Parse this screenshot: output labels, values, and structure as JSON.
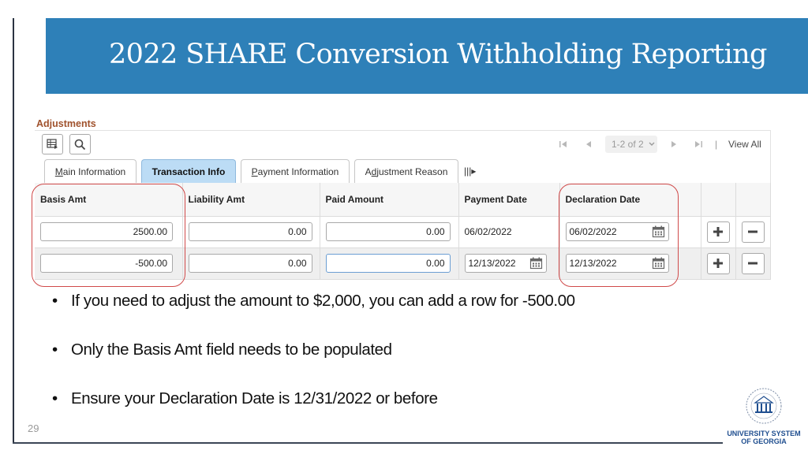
{
  "slide": {
    "title": "2022 SHARE Conversion Withholding Reporting",
    "page_number": "29",
    "accent_color": "#2e80b8",
    "highlight_color": "#d04a4a"
  },
  "grid": {
    "section_title": "Adjustments",
    "toolbar": {
      "personalize_icon": "grid-personalize-icon",
      "find_icon": "search-icon"
    },
    "pager": {
      "first_icon": "first-page-icon",
      "prev_icon": "previous-page-icon",
      "range_label": "1-2 of 2",
      "next_icon": "next-page-icon",
      "last_icon": "last-page-icon",
      "separator": "|",
      "view_all": "View All"
    },
    "tabs": [
      {
        "label_prefix": "",
        "underline": "M",
        "label_rest": "ain Information",
        "active": false
      },
      {
        "label_prefix": "",
        "underline": "",
        "label_rest": "Transaction Info",
        "active": true
      },
      {
        "label_prefix": "",
        "underline": "P",
        "label_rest": "ayment Information",
        "active": false
      },
      {
        "label_prefix": "A",
        "underline": "d",
        "label_rest": "justment Reason",
        "active": false
      }
    ],
    "show_all_tabs_icon": "|||▸",
    "columns": [
      "Basis Amt",
      "Liability Amt",
      "Paid Amount",
      "Payment Date",
      "Declaration Date",
      "",
      ""
    ],
    "rows": [
      {
        "basis_amt": "2500.00",
        "liability_amt": "0.00",
        "paid_amount": "0.00",
        "payment_date": "06/02/2022",
        "payment_date_editable": false,
        "declaration_date": "06/02/2022"
      },
      {
        "basis_amt": "-500.00",
        "liability_amt": "0.00",
        "paid_amount": "0.00",
        "payment_date": "12/13/2022",
        "payment_date_editable": true,
        "declaration_date": "12/13/2022"
      }
    ],
    "add_row_label": "+",
    "delete_row_label": "−"
  },
  "bullets": [
    "If you need to adjust the amount to $2,000, you can add a row for -500.00",
    "Only the Basis Amt field needs to be populated",
    "Ensure your Declaration Date is 12/31/2022 or before"
  ],
  "bullet_glyph": "•",
  "logo": {
    "line1": "UNIVERSITY SYSTEM",
    "line2": "OF GEORGIA"
  }
}
